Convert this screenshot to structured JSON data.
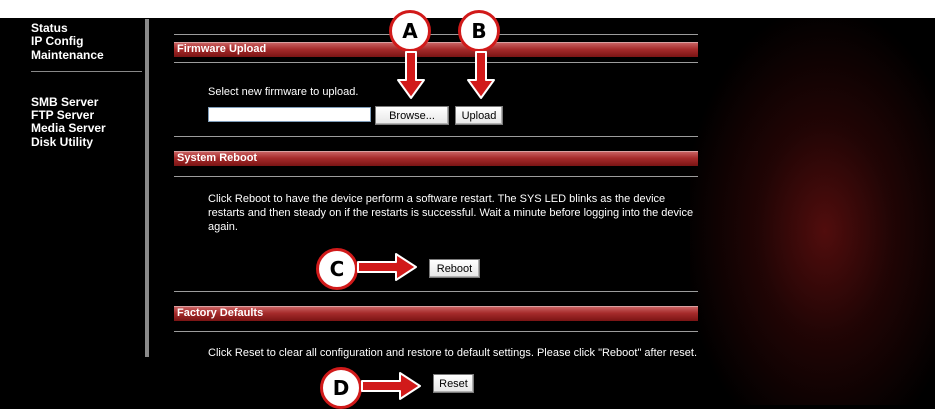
{
  "sidebar": {
    "items": [
      "Status",
      "IP Config",
      "Maintenance"
    ],
    "items2": [
      "SMB Server",
      "FTP Server",
      "Media Server",
      "Disk Utility"
    ]
  },
  "firmware": {
    "title": "Firmware Upload",
    "prompt": "Select new firmware to upload.",
    "file_value": "",
    "browse_label": "Browse...",
    "upload_label": "Upload"
  },
  "reboot": {
    "title": "System Reboot",
    "description": "Click Reboot to have the device perform a software restart. The SYS LED blinks as the device restarts and then steady on if the restarts is successful. Wait a minute before logging into the device again.",
    "button_label": "Reboot"
  },
  "factory": {
    "title": "Factory Defaults",
    "description": "Click Reset to clear all configuration and restore to default settings. Please click \"Reboot\" after reset.",
    "button_label": "Reset"
  },
  "annotations": {
    "a": "A",
    "b": "B",
    "c": "C",
    "d": "D",
    "color": "#d11a1a"
  }
}
